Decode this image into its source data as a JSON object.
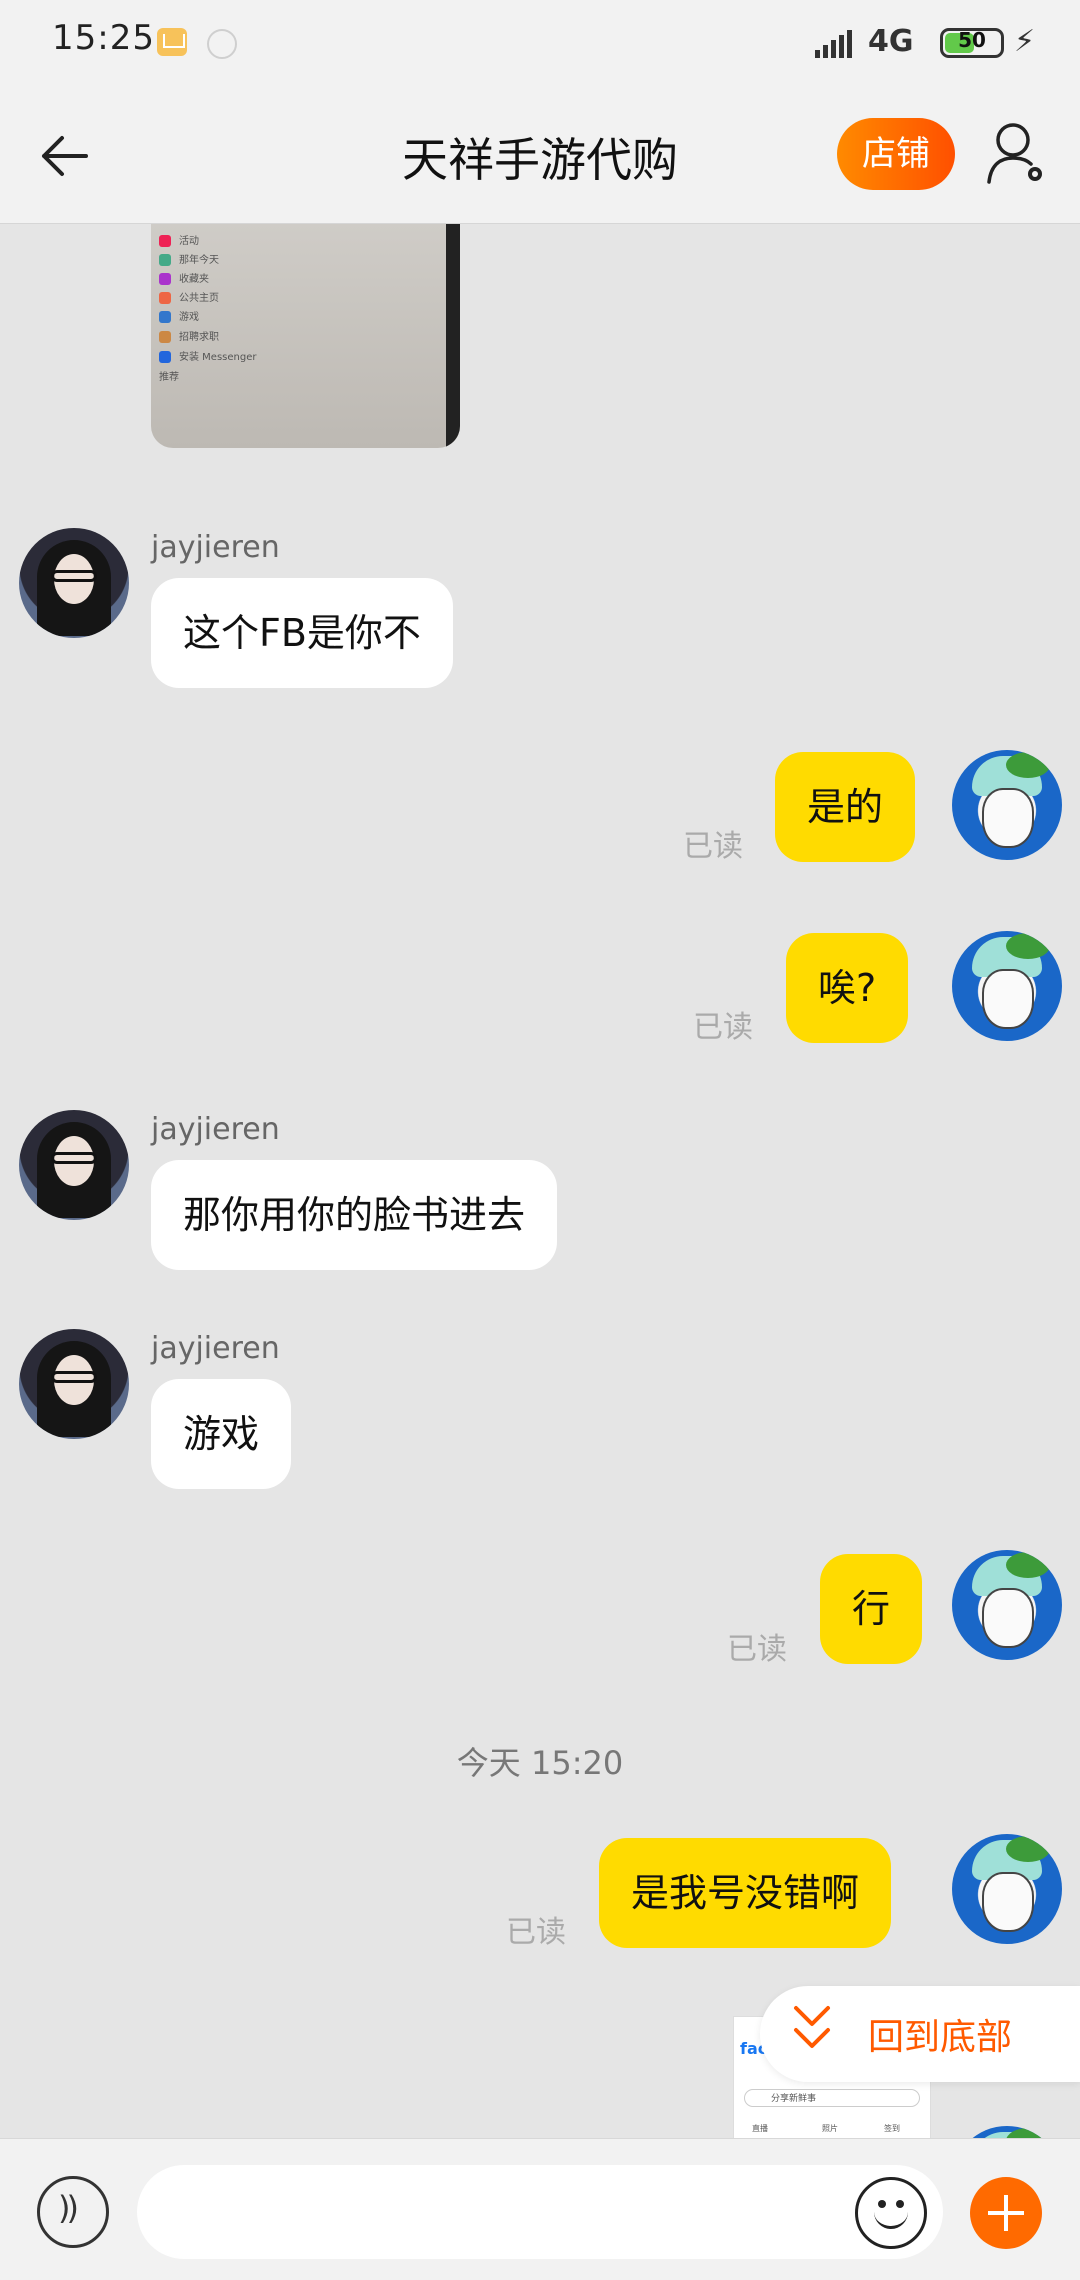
{
  "status_bar": {
    "time": "15:25",
    "network": "4G",
    "battery": "50"
  },
  "header": {
    "title": "天祥手游代购",
    "shop_button": "店铺"
  },
  "image_message_lines": [
    "活动",
    "那年今天",
    "收藏夹",
    "公共主页",
    "游戏",
    "招聘求职",
    "安装 Messenger",
    "推荐"
  ],
  "messages": [
    {
      "side": "left",
      "sender": "jayjieren",
      "text": "这个FB是你不"
    },
    {
      "side": "right",
      "text": "是的",
      "status": "已读"
    },
    {
      "side": "right",
      "text": "唉?",
      "status": "已读"
    },
    {
      "side": "left",
      "sender": "jayjieren",
      "text": "那你用你的脸书进去"
    },
    {
      "side": "left",
      "sender": "jayjieren",
      "text": "游戏"
    },
    {
      "side": "right",
      "text": "行",
      "status": "已读"
    },
    {
      "side": "divider",
      "text": "今天   15:20"
    },
    {
      "side": "right",
      "text": "是我号没错啊",
      "status": "已读"
    }
  ],
  "back_to_bottom": "回到底部",
  "thumbnail": {
    "brand": "face",
    "post_prompt": "分享新鲜事",
    "actions": [
      "直播",
      "照片",
      "签到"
    ]
  },
  "input": {
    "placeholder": ""
  }
}
